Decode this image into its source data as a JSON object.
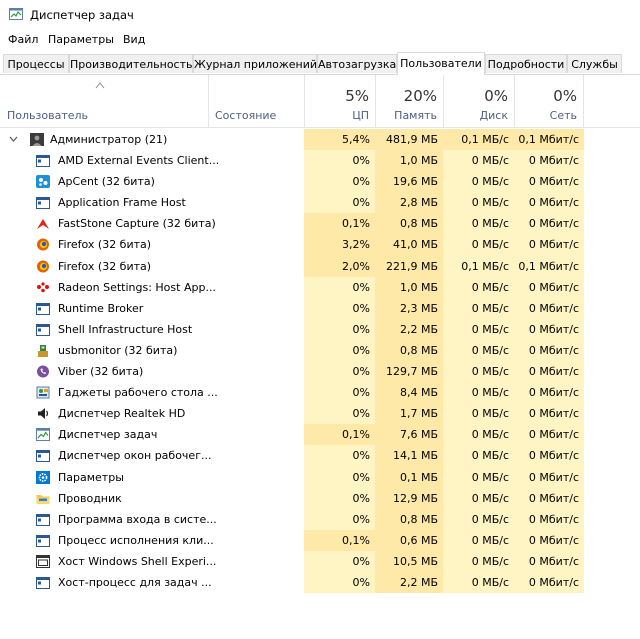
{
  "window": {
    "title": "Диспетчер задач"
  },
  "menu": [
    "Файл",
    "Параметры",
    "Вид"
  ],
  "tabs": [
    "Процессы",
    "Производительность",
    "Журнал приложений",
    "Автозагрузка",
    "Пользователи",
    "Подробности",
    "Службы"
  ],
  "active_tab": "Пользователи",
  "header": {
    "user_col": "Пользователь",
    "status_col": "Состояние",
    "cpu": {
      "pct": "5%",
      "label": "ЦП"
    },
    "mem": {
      "pct": "20%",
      "label": "Память"
    },
    "disk": {
      "pct": "0%",
      "label": "Диск"
    },
    "net": {
      "pct": "0%",
      "label": "Сеть"
    }
  },
  "group": {
    "name": "Администратор (21)",
    "cpu": "5,4%",
    "mem": "481,9 МБ",
    "disk": "0,1 МБ/с",
    "net": "0,1 Мбит/с",
    "icon": "user-icon"
  },
  "processes": [
    {
      "name": "AMD External Events Client...",
      "cpu": "0%",
      "mem": "1,0 МБ",
      "disk": "0 МБ/с",
      "net": "0 Мбит/с",
      "icon": "window-icon"
    },
    {
      "name": "ApCent (32 бита)",
      "cpu": "0%",
      "mem": "19,6 МБ",
      "disk": "0 МБ/с",
      "net": "0 Мбит/с",
      "icon": "apcent-icon"
    },
    {
      "name": "Application Frame Host",
      "cpu": "0%",
      "mem": "2,8 МБ",
      "disk": "0 МБ/с",
      "net": "0 Мбит/с",
      "icon": "window-icon"
    },
    {
      "name": "FastStone Capture (32 бита)",
      "cpu": "0,1%",
      "mem": "0,8 МБ",
      "disk": "0 МБ/с",
      "net": "0 Мбит/с",
      "icon": "faststone-icon"
    },
    {
      "name": "Firefox (32 бита)",
      "cpu": "3,2%",
      "mem": "41,0 МБ",
      "disk": "0 МБ/с",
      "net": "0 Мбит/с",
      "icon": "firefox-icon"
    },
    {
      "name": "Firefox (32 бита)",
      "cpu": "2,0%",
      "mem": "221,9 МБ",
      "disk": "0,1 МБ/с",
      "net": "0,1 Мбит/с",
      "icon": "firefox-icon"
    },
    {
      "name": "Radeon Settings: Host App...",
      "cpu": "0%",
      "mem": "1,0 МБ",
      "disk": "0 МБ/с",
      "net": "0 Мбит/с",
      "icon": "radeon-icon"
    },
    {
      "name": "Runtime Broker",
      "cpu": "0%",
      "mem": "2,3 МБ",
      "disk": "0 МБ/с",
      "net": "0 Мбит/с",
      "icon": "window-icon"
    },
    {
      "name": "Shell Infrastructure Host",
      "cpu": "0%",
      "mem": "2,2 МБ",
      "disk": "0 МБ/с",
      "net": "0 Мбит/с",
      "icon": "window-icon"
    },
    {
      "name": "usbmonitor (32 бита)",
      "cpu": "0%",
      "mem": "0,8 МБ",
      "disk": "0 МБ/с",
      "net": "0 Мбит/с",
      "icon": "usb-icon"
    },
    {
      "name": "Viber (32 бита)",
      "cpu": "0%",
      "mem": "129,7 МБ",
      "disk": "0 МБ/с",
      "net": "0 Мбит/с",
      "icon": "viber-icon"
    },
    {
      "name": "Гаджеты рабочего стола ...",
      "cpu": "0%",
      "mem": "8,4 МБ",
      "disk": "0 МБ/с",
      "net": "0 Мбит/с",
      "icon": "gadgets-icon"
    },
    {
      "name": "Диспетчер Realtek HD",
      "cpu": "0%",
      "mem": "1,7 МБ",
      "disk": "0 МБ/с",
      "net": "0 Мбит/с",
      "icon": "speaker-icon"
    },
    {
      "name": "Диспетчер задач",
      "cpu": "0,1%",
      "mem": "7,6 МБ",
      "disk": "0 МБ/с",
      "net": "0 Мбит/с",
      "icon": "taskmgr-icon"
    },
    {
      "name": "Диспетчер окон рабочег...",
      "cpu": "0%",
      "mem": "14,1 МБ",
      "disk": "0 МБ/с",
      "net": "0 Мбит/с",
      "icon": "window-icon"
    },
    {
      "name": "Параметры",
      "cpu": "0%",
      "mem": "0,1 МБ",
      "disk": "0 МБ/с",
      "net": "0 Мбит/с",
      "icon": "gear-icon"
    },
    {
      "name": "Проводник",
      "cpu": "0%",
      "mem": "12,9 МБ",
      "disk": "0 МБ/с",
      "net": "0 Мбит/с",
      "icon": "folder-icon"
    },
    {
      "name": "Программа входа в систе...",
      "cpu": "0%",
      "mem": "0,8 МБ",
      "disk": "0 МБ/с",
      "net": "0 Мбит/с",
      "icon": "window-icon"
    },
    {
      "name": "Процесс исполнения кли...",
      "cpu": "0,1%",
      "mem": "0,6 МБ",
      "disk": "0 МБ/с",
      "net": "0 Мбит/с",
      "icon": "window-icon"
    },
    {
      "name": "Хост Windows Shell Experi...",
      "cpu": "0%",
      "mem": "10,5 МБ",
      "disk": "0 МБ/с",
      "net": "0 Мбит/с",
      "icon": "shell-icon"
    },
    {
      "name": "Хост-процесс для задач ...",
      "cpu": "0%",
      "mem": "2,2 МБ",
      "disk": "0 МБ/с",
      "net": "0 Мбит/с",
      "icon": "window-icon"
    }
  ],
  "colors": {
    "cell_light": "#fff4c4",
    "cell_medium": "#ffe9a8",
    "accent": "#0078d7"
  }
}
